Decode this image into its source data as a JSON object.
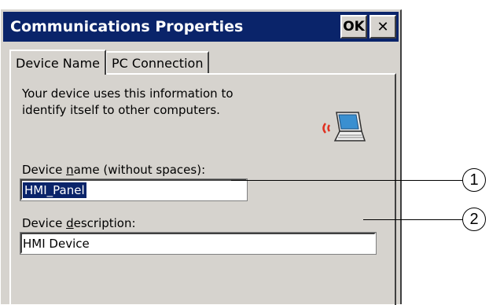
{
  "window": {
    "title": "Communications Properties",
    "ok_label": "OK",
    "close_label": "✕"
  },
  "tabs": [
    {
      "label": "Device Name",
      "active": true
    },
    {
      "label": "PC Connection",
      "active": false
    }
  ],
  "panel": {
    "description": "Your device uses this information to identify itself to other computers.",
    "device_name_label_pre": "Device ",
    "device_name_label_key": "n",
    "device_name_label_post": "ame (without spaces):",
    "device_name_value": "HMI_Panel",
    "device_description_label_pre": "Device ",
    "device_description_label_key": "d",
    "device_description_label_post": "escription:",
    "device_description_value": "HMI Device",
    "icon": "laptop-network-icon"
  },
  "callouts": [
    "1",
    "2"
  ]
}
